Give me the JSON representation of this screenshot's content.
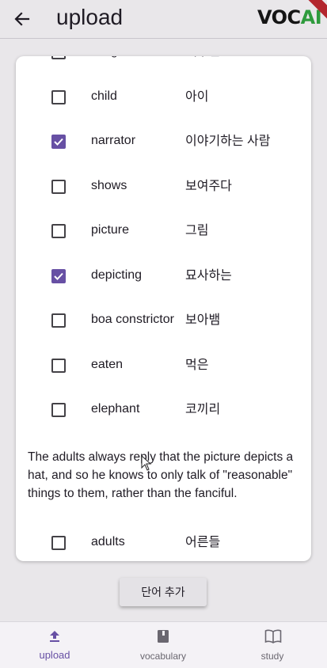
{
  "app_bar": {
    "title": "upload",
    "logo_text_primary": "VOC",
    "logo_text_accent": "AI",
    "back_icon": "arrow-left-icon"
  },
  "word_list": {
    "rows_top": [
      {
        "word": "enlightened",
        "meaning": "깨우친",
        "checked": false
      },
      {
        "word": "child",
        "meaning": "아이",
        "checked": false
      },
      {
        "word": "narrator",
        "meaning": "이야기하는 사람",
        "checked": true
      },
      {
        "word": "shows",
        "meaning": "보여주다",
        "checked": false
      },
      {
        "word": "picture",
        "meaning": "그림",
        "checked": false
      },
      {
        "word": "depicting",
        "meaning": "묘사하는",
        "checked": true
      },
      {
        "word": "boa constrictor",
        "meaning": "보아뱀",
        "checked": false
      },
      {
        "word": "eaten",
        "meaning": "먹은",
        "checked": false
      },
      {
        "word": "elephant",
        "meaning": "코끼리",
        "checked": false
      }
    ],
    "paragraph": "The adults always reply that the picture depicts a hat, and so he knows to only talk of \"reasonable\" things to them, rather than the fanciful.",
    "rows_bottom": [
      {
        "word": "adults",
        "meaning": "어른들",
        "checked": false
      }
    ]
  },
  "actions": {
    "add_words_label": "단어 추가"
  },
  "bottom_nav": {
    "items": [
      {
        "label": "upload",
        "icon": "upload-icon",
        "active": true
      },
      {
        "label": "vocabulary",
        "icon": "book-icon",
        "active": false
      },
      {
        "label": "study",
        "icon": "open-book-icon",
        "active": false
      }
    ]
  },
  "colors": {
    "accent": "#6750a4",
    "background": "#e9e7ea",
    "logo_accent": "#2e9b3d",
    "banner": "#b3262e"
  }
}
